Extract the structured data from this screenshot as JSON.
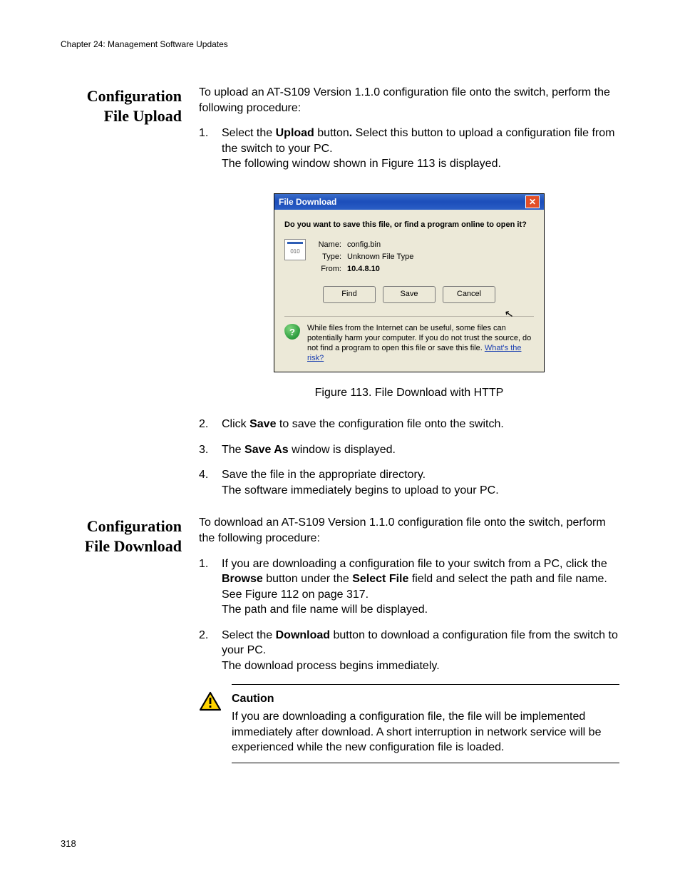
{
  "header": {
    "running_head": "Chapter 24: Management Software Updates"
  },
  "page_number": "318",
  "section_upload": {
    "heading_l1": "Configuration",
    "heading_l2": "File Upload",
    "intro": "To upload an AT-S109 Version 1.1.0  configuration file onto the switch, perform the following procedure:",
    "steps": {
      "s1_num": "1.",
      "s1_a": "Select the ",
      "s1_bold1": "Upload",
      "s1_b": " button",
      "s1_boldperiod": ".",
      "s1_c": " Select this button to upload a configuration file from the switch to your PC.",
      "s1_d": "The following window shown in Figure 113 is displayed.",
      "s2_num": "2.",
      "s2_a": "Click ",
      "s2_bold": "Save",
      "s2_b": " to save the configuration file onto the switch.",
      "s3_num": "3.",
      "s3_a": "The ",
      "s3_bold": "Save As",
      "s3_b": " window is displayed.",
      "s4_num": "4.",
      "s4_a": "Save the file in the appropriate directory.",
      "s4_b": "The software immediately begins to upload to your PC."
    },
    "figure_caption": "Figure 113. File Download with HTTP"
  },
  "dialog": {
    "title": "File Download",
    "question": "Do you want to save this file, or find a program online to open it?",
    "name_k": "Name:",
    "name_v": "config.bin",
    "type_k": "Type:",
    "type_v": "Unknown File Type",
    "from_k": "From:",
    "from_v": "10.4.8.10",
    "btn_find": "Find",
    "btn_save": "Save",
    "btn_cancel": "Cancel",
    "footer_text": "While files from the Internet can be useful, some files can potentially harm your computer. If you do not trust the source, do not find a program to open this file or save this file. ",
    "footer_link": "What's the risk?"
  },
  "section_download": {
    "heading_l1": "Configuration",
    "heading_l2": "File Download",
    "intro": "To download an AT-S109 Version 1.1.0  configuration file onto the switch, perform the following procedure:",
    "steps": {
      "s1_num": "1.",
      "s1_a": "If you are downloading a configuration file to your switch from a PC, click the ",
      "s1_bold1": "Browse",
      "s1_b": " button under the ",
      "s1_bold2": "Select File",
      "s1_c": " field and select the path and file name. See Figure 112 on page 317.",
      "s1_d": "The path and file name will be displayed.",
      "s2_num": "2.",
      "s2_a": "Select the ",
      "s2_bold": "Download",
      "s2_b": " button to download a configuration file from the switch to your PC.",
      "s2_c": "The download process begins immediately."
    },
    "caution": {
      "title": "Caution",
      "body": "If you are downloading a configuration file, the file will be implemented immediately after download. A short interruption in network service will be experienced while the new configuration file is loaded."
    }
  }
}
